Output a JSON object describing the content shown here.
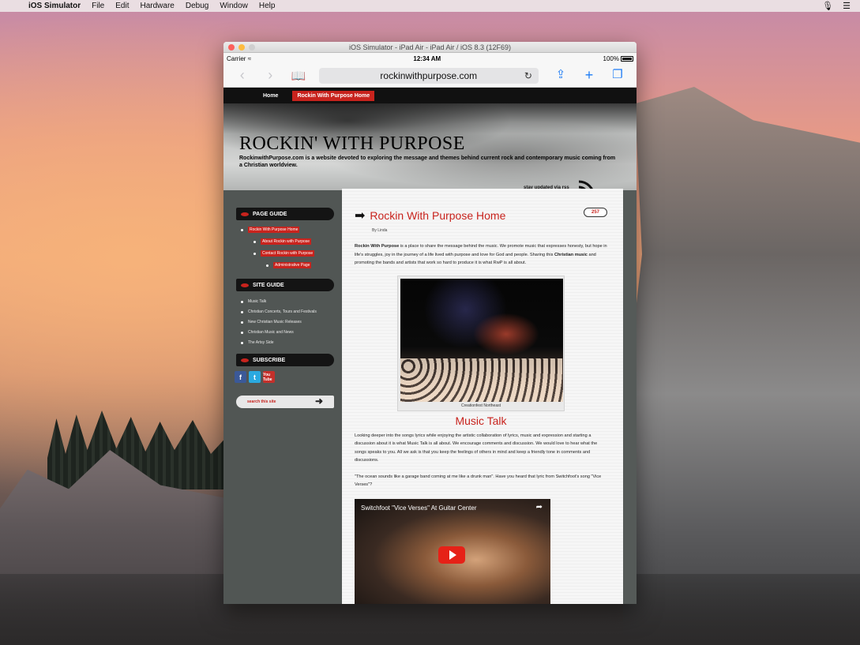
{
  "menubar": {
    "app_name": "iOS Simulator",
    "items": [
      "File",
      "Edit",
      "Hardware",
      "Debug",
      "Window",
      "Help"
    ]
  },
  "window": {
    "title": "iOS Simulator - iPad Air - iPad Air / iOS 8.3 (12F69)"
  },
  "statusbar": {
    "carrier": "Carrier",
    "time": "12:34 AM",
    "battery": "100%"
  },
  "safari": {
    "url": "rockinwithpurpose.com",
    "back_icon": "chevron-left-icon",
    "forward_icon": "chevron-right-icon",
    "bookmarks_icon": "book-icon",
    "share_icon": "share-icon",
    "add_icon": "plus-icon",
    "tabs_icon": "tabs-icon"
  },
  "site": {
    "nav": [
      "Home",
      "Rockin With Purpose Home"
    ],
    "title": "ROCKIN' WITH PURPOSE",
    "tagline": "RockinwithPurpose.com is a website devoted to exploring the message and themes behind current rock and contemporary music coming from a Christian worldview.",
    "rss_label": "stay updated via rss",
    "sidebar": {
      "page_guide_title": "PAGE GUIDE",
      "page_guide": [
        "Rockin With Purpose Home",
        "About Rockin with Purpose",
        "Contact Rockin with Purpose",
        "Administrative Page"
      ],
      "site_guide_title": "SITE GUIDE",
      "site_guide": [
        "Music Talk",
        "Christian Concerts, Tours and Festivals",
        "New Christian Music Releases",
        "Christian Music and News",
        "The Artsy Side"
      ],
      "subscribe_title": "SUBSCRIBE",
      "youtube_label": "You Tube",
      "search_placeholder": "search this site"
    },
    "post": {
      "title": "Rockin With Purpose Home",
      "comments": "257",
      "byline": "By Linda",
      "intro_bold": "Rockin With Purpose",
      "intro_rest": " is a place to share the message behind the music. We promote music that expresses honesty, but hope in life's struggles, joy in the journey of a life lived with purpose and love for God and people.  Sharing this ",
      "intro_bold2": "Christian music",
      "intro_end": " and promoting the bands and artists that work so hard to produce it is what RwP is all about.",
      "photo_caption": "Creationfest Northeast",
      "section_title": "Music Talk",
      "section_text": "Looking deeper into the songs lyrics while enjoying the artistic collaboration of lyrics, music and expression and starting a discussion about it is what Music Talk is all about. We encourage comments and discussion. We would love to hear what the songs speaks to you. All we ask is that you keep the feelings of others in mind and keep a friendly tone in comments and discussions.",
      "quote_text": "\"The ocean sounds like a garage band coming at me like a drunk man\". Have you heard that lyric from Switchfoot's song \"Vice Verses\"?",
      "video_title": "Switchfoot \"Vice Verses\" At Guitar Center"
    }
  },
  "colors": {
    "accent_red": "#c8231d",
    "ios_blue": "#1e7cf6"
  }
}
